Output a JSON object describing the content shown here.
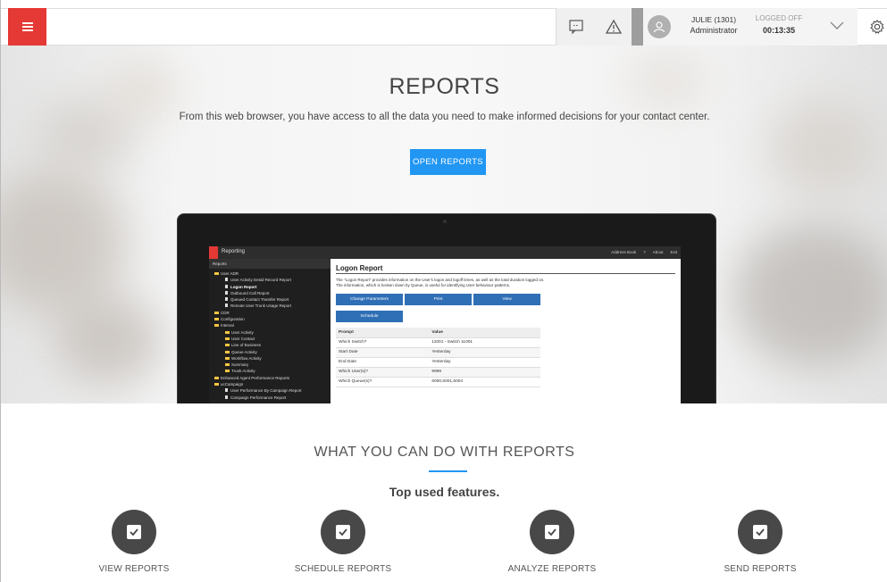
{
  "header": {
    "menu_icon": "hamburger-icon",
    "icons": [
      "chat-icon",
      "warning-icon"
    ],
    "user": {
      "name": "JULIE (1301)",
      "role": "Administrator",
      "status": "LOGGED OFF",
      "timer": "00:13:35"
    }
  },
  "hero": {
    "title": "REPORTS",
    "subtitle": "From this web browser, you have access to all the data you need to make informed decisions for your contact center.",
    "button": "OPEN REPORTS"
  },
  "laptop_screen": {
    "app_title": "Reporting",
    "tabs": [
      "Address Book",
      "?",
      "About",
      "Exit"
    ],
    "sidebar_header": "Reports",
    "tree": [
      {
        "label": "User ADR",
        "level": 1,
        "type": "folder"
      },
      {
        "label": "User Activity Detail Record Report",
        "level": 2,
        "type": "doc"
      },
      {
        "label": "Logon Report",
        "level": 2,
        "type": "doc",
        "selected": true
      },
      {
        "label": "Outbound Call Report",
        "level": 2,
        "type": "doc"
      },
      {
        "label": "Queued Contact Transfer Report",
        "level": 2,
        "type": "doc"
      },
      {
        "label": "Remote User Trunk Usage Report",
        "level": 2,
        "type": "doc"
      },
      {
        "label": "CDR",
        "level": 1,
        "type": "folder"
      },
      {
        "label": "Configuration",
        "level": 1,
        "type": "folder"
      },
      {
        "label": "Interval",
        "level": 1,
        "type": "folder"
      },
      {
        "label": "User Activity",
        "level": 2,
        "type": "folder"
      },
      {
        "label": "User Contact",
        "level": 2,
        "type": "folder"
      },
      {
        "label": "Line of Business",
        "level": 2,
        "type": "folder"
      },
      {
        "label": "Queue Activity",
        "level": 2,
        "type": "folder"
      },
      {
        "label": "Workflow Activity",
        "level": 2,
        "type": "folder"
      },
      {
        "label": "Summary",
        "level": 2,
        "type": "folder"
      },
      {
        "label": "Trunk Activity",
        "level": 2,
        "type": "folder"
      },
      {
        "label": "Enhanced Agent Performance Reports",
        "level": 1,
        "type": "folder"
      },
      {
        "label": "ucCampaign",
        "level": 1,
        "type": "folder"
      },
      {
        "label": "User Performance By Campaign Report",
        "level": 2,
        "type": "doc"
      },
      {
        "label": "Campaign Performance Report",
        "level": 2,
        "type": "doc"
      }
    ],
    "report_title": "Logon Report",
    "report_desc": "The \"Logon Report\" provides information on the User's logon and logoff times, as well as the total duration logged on. The information, which is broken down by Queue, is useful for identifying User behaviour patterns.",
    "buttons": [
      "Change Parameters",
      "Print",
      "View",
      "Schedule"
    ],
    "table_headers": [
      "Prompt",
      "Value"
    ],
    "table_rows": [
      [
        "Which Switch?",
        "11001 - Switch 11001"
      ],
      [
        "Start Date",
        "Yesterday"
      ],
      [
        "End Date",
        "Yesterday"
      ],
      [
        "Which User(s)?",
        "9999"
      ],
      [
        "Which Queue(s)?",
        "6000,6001,6004"
      ]
    ]
  },
  "features": {
    "title": "WHAT YOU CAN DO WITH REPORTS",
    "subtitle": "Top used features.",
    "items": [
      {
        "label": "VIEW REPORTS",
        "icon": "checkbox-icon"
      },
      {
        "label": "SCHEDULE REPORTS",
        "icon": "checkbox-icon"
      },
      {
        "label": "ANALYZE REPORTS",
        "icon": "checkbox-icon"
      },
      {
        "label": "SEND REPORTS",
        "icon": "checkbox-icon"
      }
    ]
  },
  "colors": {
    "brand_red": "#e53935",
    "accent_blue": "#2196f3",
    "feature_circle": "#484848"
  }
}
